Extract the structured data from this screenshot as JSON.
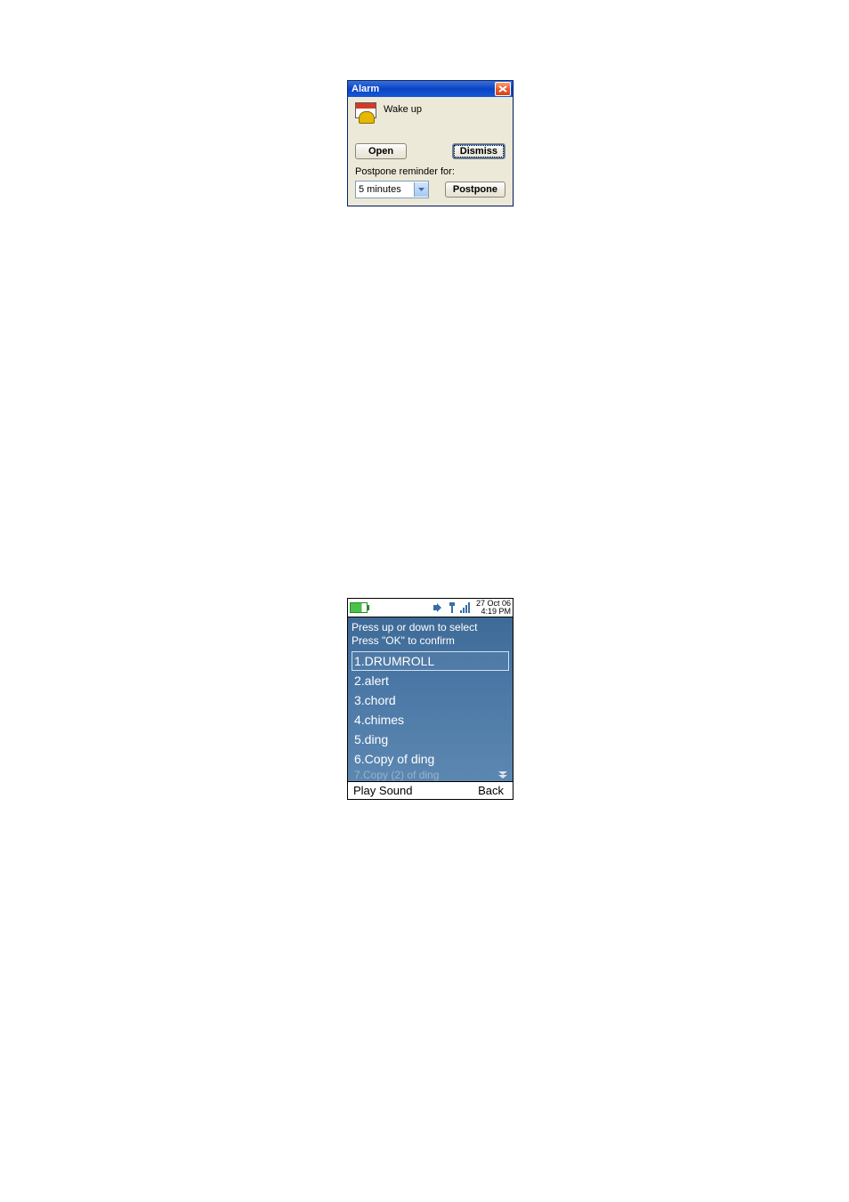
{
  "alarm": {
    "title": "Alarm",
    "subject": "Wake up",
    "open_label": "Open",
    "dismiss_label": "Dismiss",
    "postpone_text": "Postpone reminder for:",
    "postpone_value": "5 minutes",
    "postpone_button": "Postpone"
  },
  "mobile": {
    "date": "27 Oct 06",
    "time": "4:19 PM",
    "instruction1": "Press up or down to select",
    "instruction2": "Press \"OK\" to confirm",
    "items": [
      "1.DRUMROLL",
      "2.alert",
      "3.chord",
      "4.chimes",
      "5.ding",
      "6.Copy of ding",
      "7.Copy (2) of ding"
    ],
    "soft_left": "Play Sound",
    "soft_right": "Back"
  }
}
